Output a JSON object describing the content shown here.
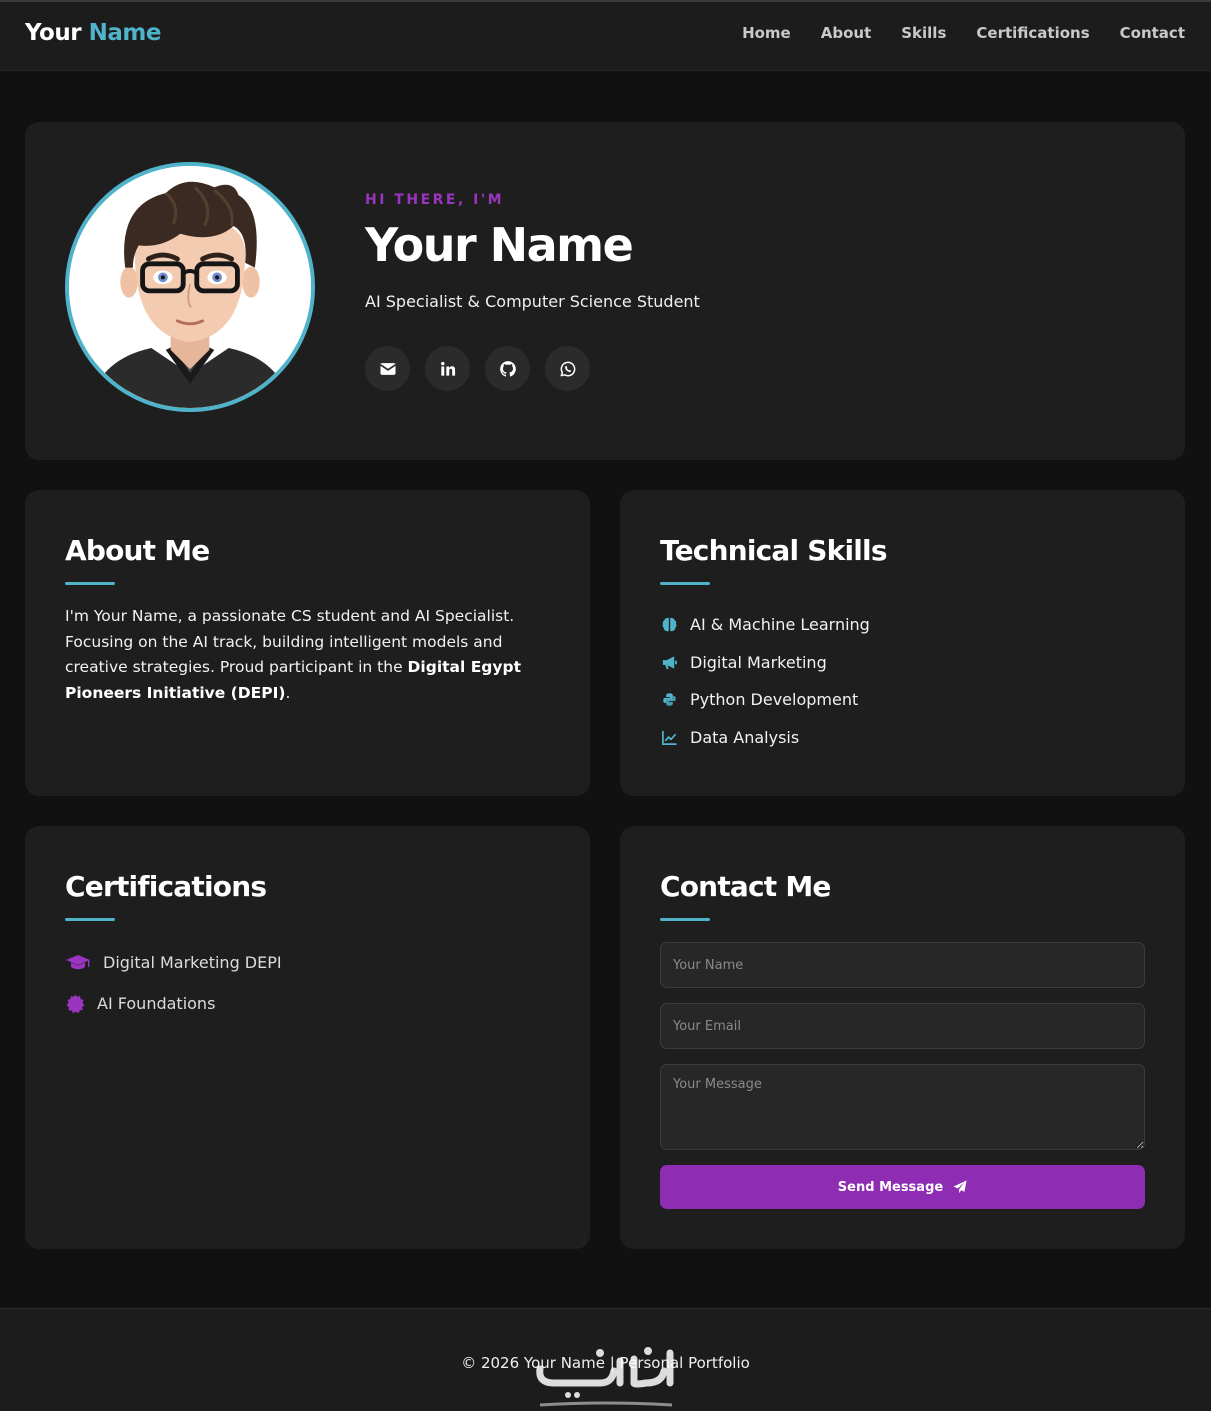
{
  "nav": {
    "logo_first": "Your",
    "logo_second": "Name",
    "links": [
      "Home",
      "About",
      "Skills",
      "Certifications",
      "Contact"
    ]
  },
  "hero": {
    "greeting": "HI THERE, I'M",
    "name": "Your Name",
    "subtitle": "AI Specialist & Computer Science Student",
    "socials": [
      "envelope-icon",
      "linkedin-icon",
      "github-icon",
      "whatsapp-icon"
    ]
  },
  "about": {
    "title": "About Me",
    "text_before": "I'm Your Name, a passionate CS student and AI Specialist. Focusing on the AI track, building intelligent models and creative strategies. Proud participant in the ",
    "text_bold": "Digital Egypt Pioneers Initiative (DEPI)",
    "text_after": "."
  },
  "skills": {
    "title": "Technical Skills",
    "items": [
      {
        "label": "AI & Machine Learning",
        "icon": "brain-icon"
      },
      {
        "label": "Digital Marketing",
        "icon": "bullhorn-icon"
      },
      {
        "label": "Python Development",
        "icon": "python-icon"
      },
      {
        "label": "Data Analysis",
        "icon": "chart-line-icon"
      }
    ]
  },
  "certifications": {
    "title": "Certifications",
    "items": [
      {
        "label": "Digital Marketing DEPI",
        "icon": "graduation-cap-icon"
      },
      {
        "label": "AI Foundations",
        "icon": "certificate-badge-icon"
      }
    ]
  },
  "contact": {
    "title": "Contact Me",
    "name_placeholder": "Your Name",
    "email_placeholder": "Your Email",
    "message_placeholder": "Your Message",
    "send_label": "Send Message"
  },
  "footer": {
    "text": "© 2026 Your Name | Personal Portfolio"
  },
  "colors": {
    "accent": "#4fb3c9",
    "purple": "#8e2db3",
    "background": "#111111",
    "card": "#1e1e1e"
  }
}
